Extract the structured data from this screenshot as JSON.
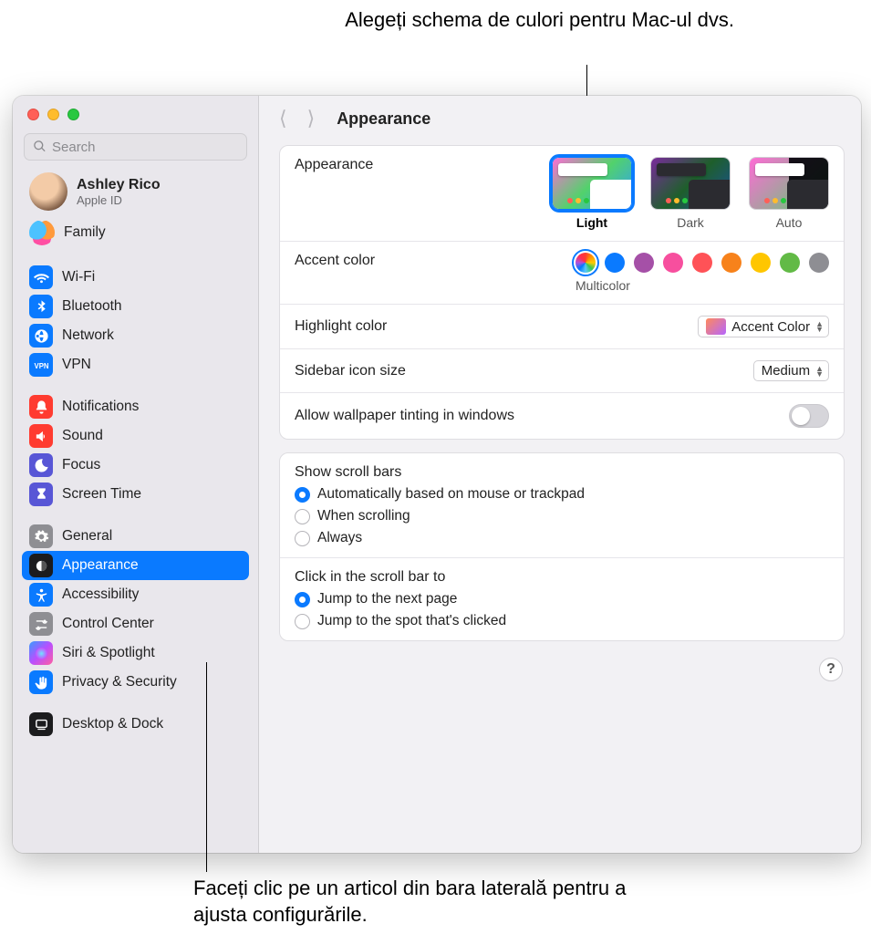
{
  "callouts": {
    "top": "Alegeți schema de culori pentru Mac-ul dvs.",
    "bottom": "Faceți clic pe un articol din bara laterală pentru a ajusta configurările."
  },
  "search": {
    "placeholder": "Search"
  },
  "account": {
    "name": "Ashley Rico",
    "sub": "Apple ID"
  },
  "family_label": "Family",
  "sidebar_groups": [
    [
      {
        "id": "wifi",
        "label": "Wi-Fi",
        "color": "#0a7aff",
        "icon": "wifi"
      },
      {
        "id": "bluetooth",
        "label": "Bluetooth",
        "color": "#0a7aff",
        "icon": "bt"
      },
      {
        "id": "network",
        "label": "Network",
        "color": "#0a7aff",
        "icon": "net"
      },
      {
        "id": "vpn",
        "label": "VPN",
        "color": "#0a7aff",
        "icon": "vpn"
      }
    ],
    [
      {
        "id": "notifications",
        "label": "Notifications",
        "color": "#ff3b30",
        "icon": "bell"
      },
      {
        "id": "sound",
        "label": "Sound",
        "color": "#ff3b30",
        "icon": "sound"
      },
      {
        "id": "focus",
        "label": "Focus",
        "color": "#5856d6",
        "icon": "moon"
      },
      {
        "id": "screentime",
        "label": "Screen Time",
        "color": "#5856d6",
        "icon": "hourglass"
      }
    ],
    [
      {
        "id": "general",
        "label": "General",
        "color": "#8e8e93",
        "icon": "gear"
      },
      {
        "id": "appearance",
        "label": "Appearance",
        "color": "#1c1c1e",
        "icon": "appearance"
      },
      {
        "id": "accessibility",
        "label": "Accessibility",
        "color": "#0a7aff",
        "icon": "access"
      },
      {
        "id": "controlcenter",
        "label": "Control Center",
        "color": "#8e8e93",
        "icon": "cc"
      },
      {
        "id": "siri",
        "label": "Siri & Spotlight",
        "color": "grad",
        "icon": "siri"
      },
      {
        "id": "privacy",
        "label": "Privacy & Security",
        "color": "#0a7aff",
        "icon": "hand"
      }
    ],
    [
      {
        "id": "desktop",
        "label": "Desktop & Dock",
        "color": "#1c1c1e",
        "icon": "dock"
      }
    ]
  ],
  "sidebar_selected": "appearance",
  "title": "Appearance",
  "appearance": {
    "label": "Appearance",
    "themes": [
      {
        "id": "light",
        "label": "Light"
      },
      {
        "id": "dark",
        "label": "Dark"
      },
      {
        "id": "auto",
        "label": "Auto"
      }
    ],
    "selected_theme": "light"
  },
  "accent": {
    "label": "Accent color",
    "selected_label": "Multicolor",
    "colors": [
      "multicolor",
      "#0a7aff",
      "#a550a7",
      "#f74f9e",
      "#ff5257",
      "#f7821b",
      "#ffc600",
      "#62ba46",
      "#8e8e93"
    ]
  },
  "highlight": {
    "label": "Highlight color",
    "value": "Accent Color"
  },
  "sidebar_size": {
    "label": "Sidebar icon size",
    "value": "Medium"
  },
  "tinting": {
    "label": "Allow wallpaper tinting in windows",
    "on": false
  },
  "scrollbars": {
    "label": "Show scroll bars",
    "options": [
      "Automatically based on mouse or trackpad",
      "When scrolling",
      "Always"
    ],
    "selected": 0
  },
  "click_scroll": {
    "label": "Click in the scroll bar to",
    "options": [
      "Jump to the next page",
      "Jump to the spot that's clicked"
    ],
    "selected": 0
  },
  "help_glyph": "?"
}
